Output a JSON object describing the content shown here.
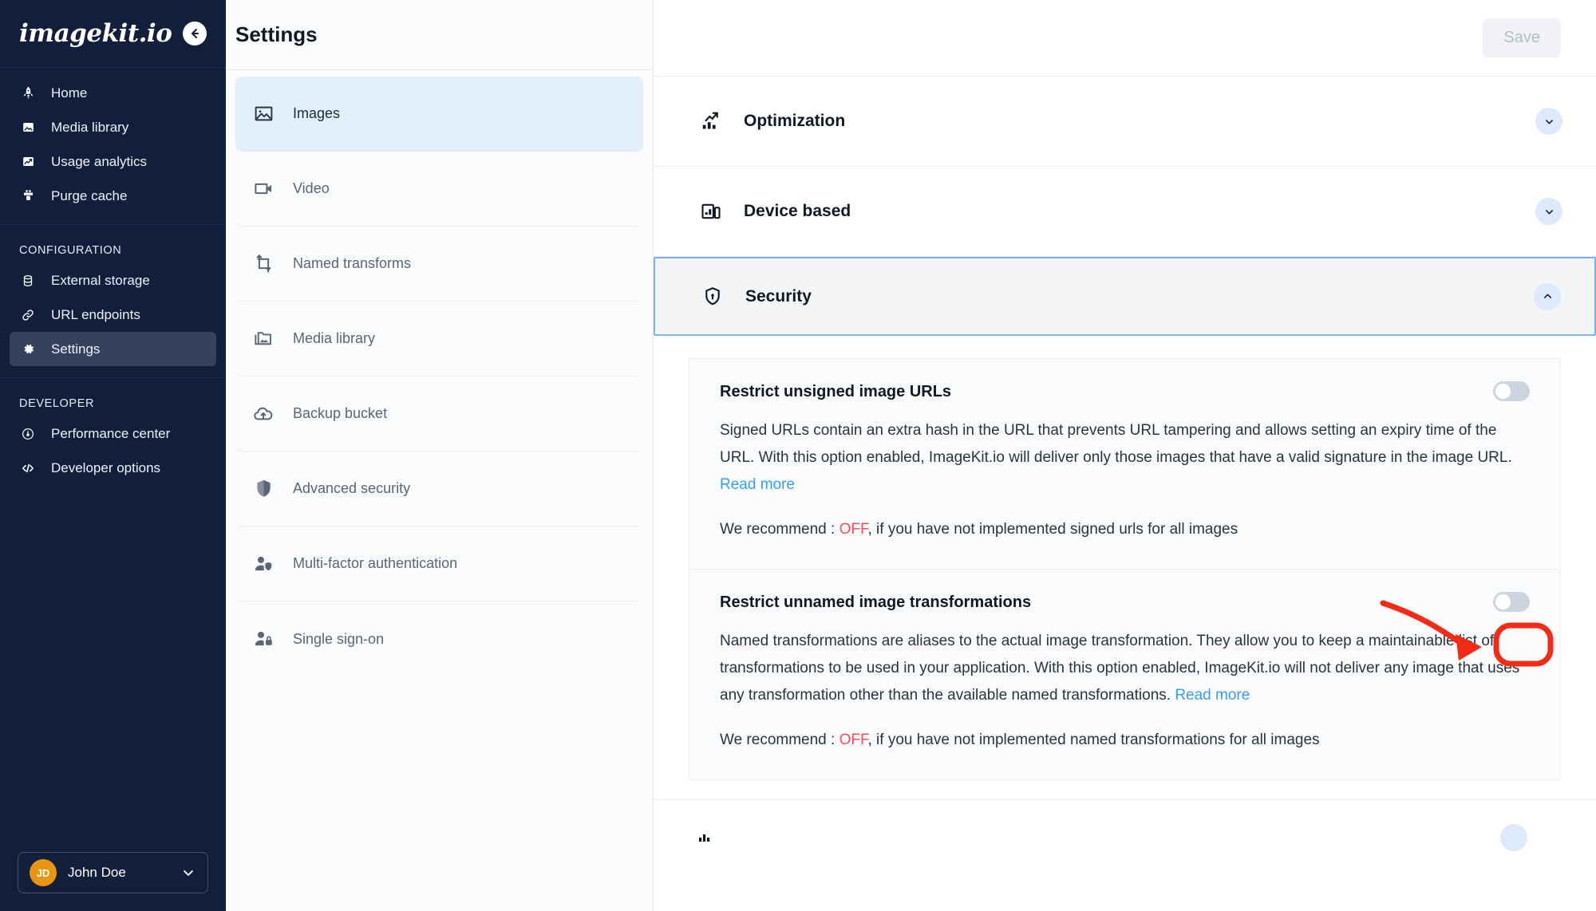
{
  "sidebar": {
    "brand": "imagekit.io",
    "collapse_icon": "arrow-left-circle-icon",
    "primary_items": [
      {
        "label": "Home",
        "icon": "rocket-icon"
      },
      {
        "label": "Media library",
        "icon": "image-stack-icon"
      },
      {
        "label": "Usage analytics",
        "icon": "analytics-icon"
      },
      {
        "label": "Purge cache",
        "icon": "purge-cache-icon"
      }
    ],
    "configuration_label": "CONFIGURATION",
    "configuration_items": [
      {
        "label": "External storage",
        "icon": "database-icon"
      },
      {
        "label": "URL endpoints",
        "icon": "link-icon"
      },
      {
        "label": "Settings",
        "icon": "gear-icon",
        "active": true
      }
    ],
    "developer_label": "DEVELOPER",
    "developer_items": [
      {
        "label": "Performance center",
        "icon": "speedometer-icon"
      },
      {
        "label": "Developer options",
        "icon": "code-icon"
      }
    ],
    "user": {
      "initials": "JD",
      "name": "John Doe",
      "caret_icon": "chevron-down-icon",
      "avatar_color": "#e8950f"
    }
  },
  "settings_panel": {
    "title": "Settings",
    "items": [
      {
        "label": "Images",
        "icon": "image-icon",
        "active": true
      },
      {
        "label": "Video",
        "icon": "video-camera-icon",
        "active": false
      },
      {
        "label": "Named transforms",
        "icon": "crop-icon",
        "active": false
      },
      {
        "label": "Media library",
        "icon": "folder-image-icon",
        "active": false
      },
      {
        "label": "Backup bucket",
        "icon": "cloud-upload-icon",
        "active": false
      },
      {
        "label": "Advanced security",
        "icon": "shield-icon",
        "active": false
      },
      {
        "label": "Multi-factor authentication",
        "icon": "user-shield-icon",
        "active": false
      },
      {
        "label": "Single sign-on",
        "icon": "user-lock-icon",
        "active": false
      }
    ]
  },
  "main": {
    "save_label": "Save",
    "accordions": [
      {
        "label": "Optimization",
        "icon": "chart-arrow-up-icon",
        "expanded": false,
        "chevron": "chevron-down-icon"
      },
      {
        "label": "Device based",
        "icon": "device-icon",
        "expanded": false,
        "chevron": "chevron-down-icon"
      },
      {
        "label": "Security",
        "icon": "shield-lock-icon",
        "expanded": true,
        "chevron": "chevron-up-icon"
      }
    ],
    "tail_accordion": {
      "label": "",
      "icon": "partial-icon"
    },
    "security_options": [
      {
        "title": "Restrict unsigned image URLs",
        "description_before_link": "Signed URLs contain an extra hash in the URL that prevents URL tampering and allows setting an expiry time of the URL. With this option enabled, ImageKit.io will deliver only those images that have a valid signature in the image URL. ",
        "link_text": "Read more",
        "recommend_prefix": "We recommend : ",
        "recommend_value": "OFF",
        "recommend_suffix": ", if you have not implemented signed urls for all images",
        "toggle_state": "off"
      },
      {
        "title": "Restrict unnamed image transformations",
        "description_before_link": "Named transformations are aliases to the actual image transformation. They allow you to keep a maintainable list of transformations to be used in your application. With this option enabled, ImageKit.io will not deliver any image that uses any transformation other than the available named transformations. ",
        "link_text": "Read more",
        "recommend_prefix": "We recommend : ",
        "recommend_value": "OFF",
        "recommend_suffix": ", if you have not implemented named transformations for all images",
        "toggle_state": "off",
        "highlighted": true
      }
    ]
  },
  "annotation": {
    "color": "#f42b14",
    "shape": "curved-arrow-pointing-to-toggle",
    "target": "restrict-unnamed-image-transformations-toggle"
  }
}
